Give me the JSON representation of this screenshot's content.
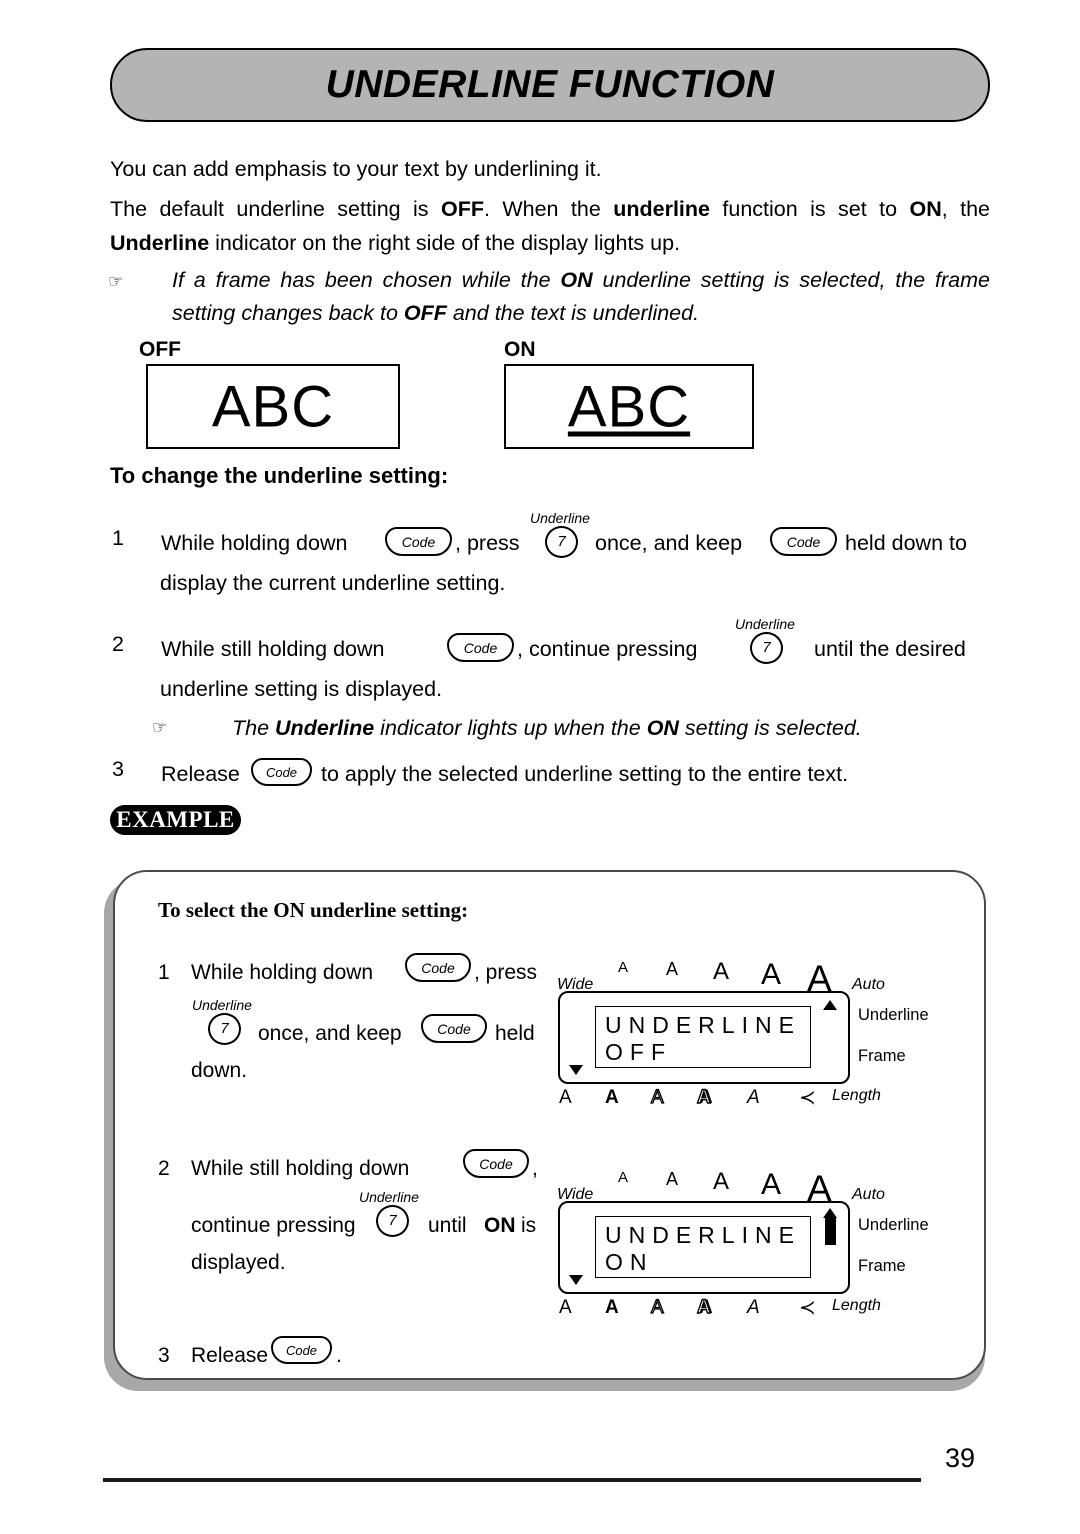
{
  "page": {
    "title": "UNDERLINE FUNCTION",
    "number": "39"
  },
  "intro": {
    "line1": "You can add emphasis to your text by underlining it.",
    "para2_a": "The default underline setting is ",
    "para2_off": "OFF",
    "para2_b": ". When the ",
    "para2_underline": "underline",
    "para2_c": " function is set to ",
    "para2_on": "ON",
    "para2_d": ", the ",
    "para2_Underline": "Underline",
    "para2_e": " indicator on the right side of the display lights up."
  },
  "note1": {
    "icon": "pointing-hand-icon",
    "text_a": "If a frame has been chosen while the ",
    "text_on": "ON",
    "text_b": " underline setting is selected, the frame setting changes back to ",
    "text_off": "OFF",
    "text_c": " and the text is underlined."
  },
  "samples": {
    "off_label": "OFF",
    "on_label": "ON",
    "off_text": "ABC",
    "on_text": "ABC"
  },
  "subhead": "To change the underline setting:",
  "steps": [
    {
      "num": "1",
      "seg1": "While holding down",
      "key1": "Code",
      "seg2": ", press",
      "key2": "7",
      "key2_caption": "Underline",
      "seg3": "once, and keep",
      "key3": "Code",
      "seg4": "held down to",
      "line2": "display the current underline setting."
    },
    {
      "num": "2",
      "seg1": "While still holding down",
      "key1": "Code",
      "seg2": ", continue pressing",
      "key2": "7",
      "key2_caption": "Underline",
      "seg3": "until the desired",
      "line2": "underline setting is displayed."
    },
    {
      "num": "3",
      "seg1": "Release",
      "key1": "Code",
      "seg2": "to apply the selected underline setting to the entire text."
    }
  ],
  "note2": {
    "icon": "pointing-hand-icon",
    "text_a": "The ",
    "text_underline": "Underline",
    "text_b": " indicator lights up when the ",
    "text_on": "ON",
    "text_c": " setting is selected."
  },
  "example": {
    "badge": "EXAMPLE",
    "title": "To select the ON underline setting:",
    "steps": [
      {
        "num": "1",
        "line1_a": "While  holding  down",
        "key_code_1": "Code",
        "line1_b": ",  press",
        "key_7": "7",
        "key_7_caption": "Underline",
        "line2_a": "once, and keep",
        "key_code_2": "Code",
        "line2_b": "held",
        "line3": "down."
      },
      {
        "num": "2",
        "line1_a": "While  still  holding  down",
        "key_code_1": "Code",
        "line1_b": ",",
        "line2_a": "continue pressing",
        "key_7": "7",
        "key_7_caption": "Underline",
        "line2_b": "until",
        "line2_on": "ON",
        "line2_c": "is",
        "line3": "displayed."
      },
      {
        "num": "3",
        "line1_a": "Release",
        "key_code_1": "Code",
        "line1_b": "."
      }
    ]
  },
  "lcd": [
    {
      "id": "lcd-off",
      "top_left_label": "Wide",
      "top_right_label": "Auto",
      "size_indicators": [
        "A",
        "A",
        "A",
        "A",
        "A"
      ],
      "display_line1": "UNDERLINE",
      "display_line2": "OFF",
      "right_labels": [
        "Underline",
        "Frame"
      ],
      "bottom_styles": [
        "A",
        "A",
        "A",
        "A",
        "A"
      ],
      "length_glyph": "≺",
      "length_label": "Length",
      "underline_indicator_lit": false
    },
    {
      "id": "lcd-on",
      "top_left_label": "Wide",
      "top_right_label": "Auto",
      "size_indicators": [
        "A",
        "A",
        "A",
        "A",
        "A"
      ],
      "display_line1": "UNDERLINE",
      "display_line2": "ON",
      "right_labels": [
        "Underline",
        "Frame"
      ],
      "bottom_styles": [
        "A",
        "A",
        "A",
        "A",
        "A"
      ],
      "length_glyph": "≺",
      "length_label": "Length",
      "underline_indicator_lit": true
    }
  ]
}
